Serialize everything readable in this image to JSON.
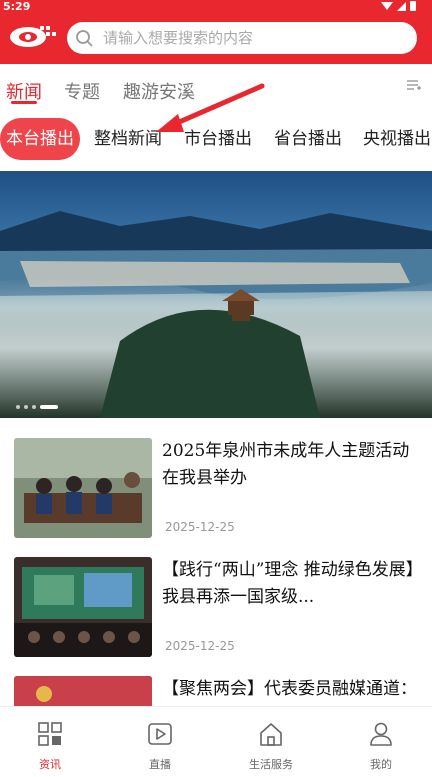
{
  "status_bar": {
    "time": "5:29"
  },
  "search": {
    "placeholder": "请输入想要搜索的内容"
  },
  "top_tabs": [
    {
      "label": "新闻",
      "active": true
    },
    {
      "label": "专题",
      "active": false
    },
    {
      "label": "趣游安溪",
      "active": false
    }
  ],
  "sub_tabs": [
    {
      "label": "本台播出",
      "active": true
    },
    {
      "label": "整档新闻",
      "active": false
    },
    {
      "label": "市台播出",
      "active": false
    },
    {
      "label": "省台播出",
      "active": false
    },
    {
      "label": "央视播出",
      "active": false
    }
  ],
  "banner": {
    "dot_count": 4,
    "active_dot": 3
  },
  "news": [
    {
      "title": "2025年泉州市未成年人主题活动在我县举办",
      "date": "2025-12-25"
    },
    {
      "title": "【践行“两山”理念 推动绿色发展】我县再添一国家级...",
      "date": "2025-12-25"
    },
    {
      "title": "【聚焦两会】代表委员融媒通道：聚力增福社惠民生 书写...",
      "date": ""
    }
  ],
  "bottom_nav": [
    {
      "label": "资讯",
      "icon": "grid-icon",
      "active": true
    },
    {
      "label": "直播",
      "icon": "play-icon",
      "active": false
    },
    {
      "label": "生活服务",
      "icon": "home-icon",
      "active": false
    },
    {
      "label": "我的",
      "icon": "user-icon",
      "active": false
    }
  ],
  "colors": {
    "brand_red": "#e8272f",
    "chip_red": "#f0444b"
  }
}
